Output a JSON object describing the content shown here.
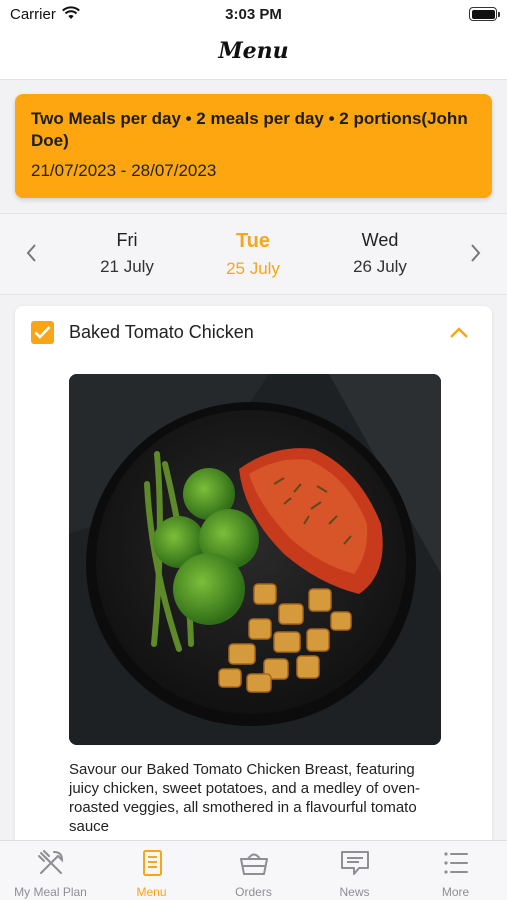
{
  "status_bar": {
    "carrier": "Carrier",
    "time": "3:03 PM"
  },
  "nav": {
    "title": "Menu"
  },
  "plan": {
    "title": "Two Meals per day • 2 meals per day • 2 portions(John Doe)",
    "dates": "21/07/2023 - 28/07/2023"
  },
  "days": [
    {
      "name": "Fri",
      "date": "21 July"
    },
    {
      "name": "Tue",
      "date": "25 July"
    },
    {
      "name": "Wed",
      "date": "26 July"
    }
  ],
  "meal": {
    "name": "Baked Tomato Chicken",
    "checked": true,
    "description": "Savour our Baked Tomato Chicken Breast, featuring juicy chicken, sweet potatoes, and a medley of oven-roasted veggies, all smothered in a flavourful tomato sauce"
  },
  "tabs": [
    {
      "label": "My Meal Plan",
      "icon": "utensils-icon"
    },
    {
      "label": "Menu",
      "icon": "menu-document-icon"
    },
    {
      "label": "Orders",
      "icon": "basket-icon"
    },
    {
      "label": "News",
      "icon": "chat-bubble-icon"
    },
    {
      "label": "More",
      "icon": "list-icon"
    }
  ],
  "colors": {
    "accent": "#f7a51b",
    "banner": "#fda60f",
    "inactive": "#8e8e93"
  }
}
